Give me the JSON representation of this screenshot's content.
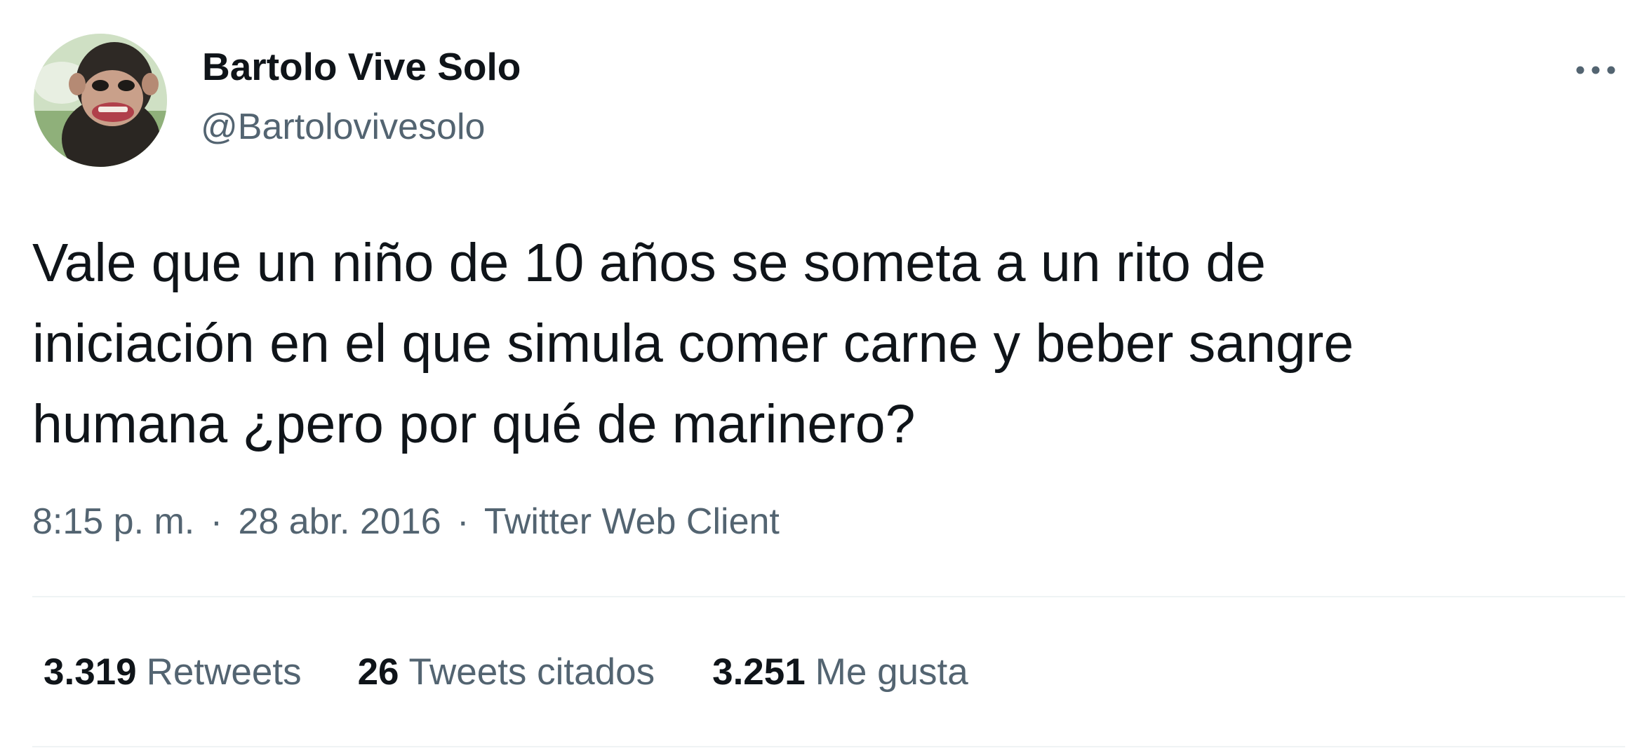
{
  "author": {
    "display_name": "Bartolo Vive Solo",
    "handle": "@Bartolovivesolo",
    "avatar_icon": "chimpanzee-avatar"
  },
  "menu": {
    "more_icon": "more-horizontal-icon"
  },
  "tweet": {
    "text_lines": [
      "Vale que un niño de 10 años se someta a un rito de",
      "iniciación en el que simula comer carne y beber sangre",
      "humana ¿pero por qué de marinero?"
    ]
  },
  "meta": {
    "time": "8:15 p. m.",
    "separator": "·",
    "date": "28 abr. 2016",
    "source": "Twitter Web Client"
  },
  "stats": [
    {
      "value": "3.319",
      "label": "Retweets"
    },
    {
      "value": "26",
      "label": "Tweets citados"
    },
    {
      "value": "3.251",
      "label": "Me gusta"
    }
  ],
  "colors": {
    "primary_text": "#0f1419",
    "secondary_text": "#536471",
    "divider": "#eff3f4"
  }
}
